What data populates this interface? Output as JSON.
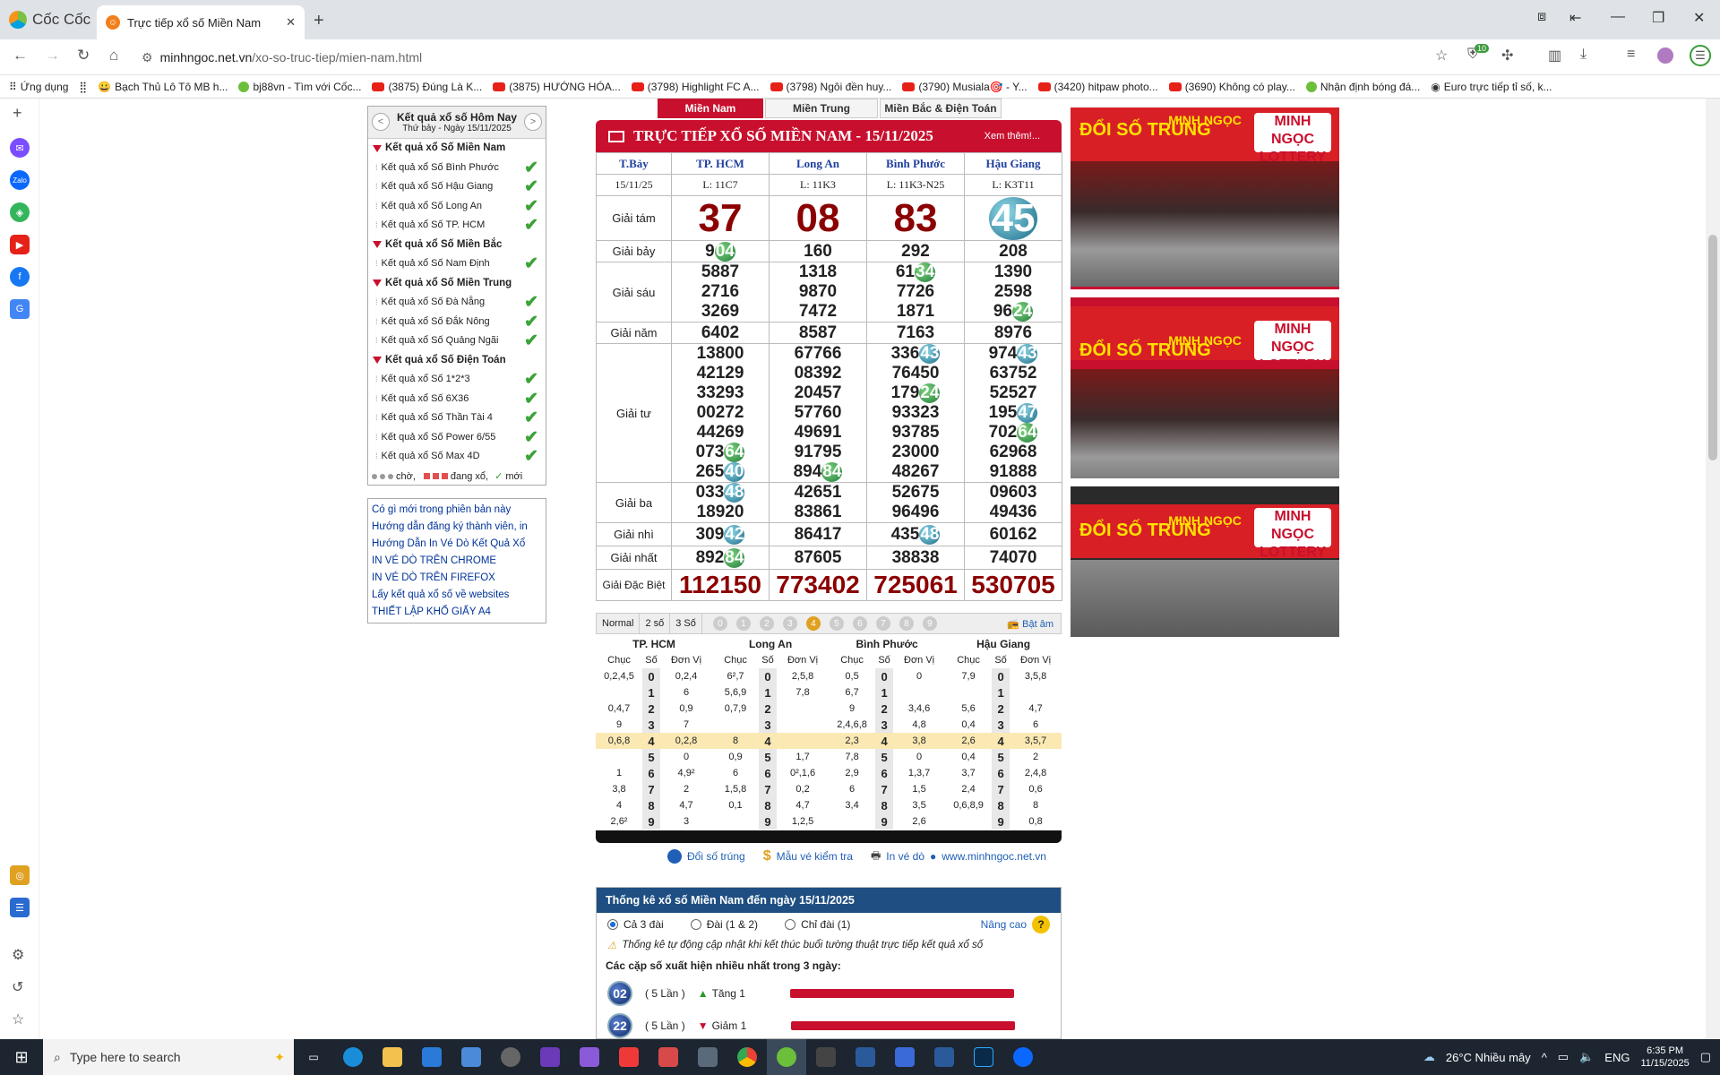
{
  "browser": {
    "app_name": "Cốc Cốc",
    "tab_title": "Trực tiếp xổ số Miền Nam",
    "url_domain": "minhngoc.net.vn",
    "url_path": "/xo-so-truc-tiep/mien-nam.html",
    "ext_badge": "10",
    "bookmarks": [
      "Ứng dụng",
      "Bạch Thủ Lô Tô MB h...",
      "bj88vn - Tìm với Cốc...",
      "(3875) Đúng Là K...",
      "(3875) HƯỚNG HÓA...",
      "(3798) Highlight FC A...",
      "(3798) Ngôi đền huy...",
      "(3790) Musiala🎯 - Y...",
      "(3420) hitpaw photo...",
      "(3690) Không có play...",
      "Nhận định bóng đá...",
      "Euro trực tiếp tỉ số, k..."
    ]
  },
  "sidebar_menu": {
    "title": "Kết quả xổ số Hôm Nay",
    "subtitle": "Thứ bảy - Ngày 15/11/2025",
    "groups": [
      {
        "label": "Kết quả xổ Số Miền Nam",
        "items": [
          "Kết quả xổ Số Bình Phước",
          "Kết quả xổ Số Hậu Giang",
          "Kết quả xổ Số Long An",
          "Kết quả xổ Số TP. HCM"
        ]
      },
      {
        "label": "Kết quả xổ Số Miền Bắc",
        "items": [
          "Kết quả xổ Số Nam Định"
        ]
      },
      {
        "label": "Kết quả xổ Số Miền Trung",
        "items": [
          "Kết quả xổ Số Đà Nẵng",
          "Kết quả xổ Số Đắk Nông",
          "Kết quả xổ Số Quảng Ngãi"
        ]
      },
      {
        "label": "Kết quả xổ Số Điện Toán",
        "items": [
          "Kết quả xổ Số 1*2*3",
          "Kết quả xổ Số 6X36",
          "Kết quả xổ Số Thần Tài 4",
          "Kết quả xổ Số Power 6/55",
          "Kết quả xổ Số Max 4D"
        ]
      }
    ],
    "legend_wait": "chờ,",
    "legend_live": "đang xổ,",
    "legend_new": "mới"
  },
  "info_links": [
    "Có gì mới trong phiên bản này",
    "Hướng dẫn đăng ký thành viên, in",
    "Hướng Dẫn In Vé Dò Kết Quả Xổ",
    "IN VÉ DÒ TRÊN CHROME",
    "IN VÉ DÒ TRÊN FIREFOX",
    "Lấy kết quả xổ số về websites",
    "THIẾT LẬP KHỔ GIẤY A4"
  ],
  "region_tabs": [
    "Miền Nam",
    "Miền Trung",
    "Miền Bắc & Điện Toán"
  ],
  "results": {
    "header": "TRỰC TIẾP XỔ SỐ MIỀN NAM - 15/11/2025",
    "more": "Xem thêm!...",
    "day": "T.Bảy",
    "date": "15/11/25",
    "provinces": [
      "TP. HCM",
      "Long An",
      "Bình Phước",
      "Hậu Giang"
    ],
    "codes": [
      "L: 11C7",
      "L: 11K3",
      "L: 11K3-N25",
      "L: K3T11"
    ],
    "prize_labels": {
      "g8": "Giải tám",
      "g7": "Giải bảy",
      "g6": "Giải sáu",
      "g5": "Giải năm",
      "g4": "Giải tư",
      "g3": "Giải ba",
      "g2": "Giải nhì",
      "g1": "Giải nhất",
      "db": "Giải Đặc Biệt"
    },
    "g8": [
      "37",
      "08",
      "83",
      "45"
    ],
    "g7": [
      "904",
      "160",
      "292",
      "208"
    ],
    "g6": [
      [
        "5887",
        "2716",
        "3269"
      ],
      [
        "1318",
        "9870",
        "7472"
      ],
      [
        "6134",
        "7726",
        "1871"
      ],
      [
        "1390",
        "2598",
        "9624"
      ]
    ],
    "g5": [
      "6402",
      "8587",
      "7163",
      "8976"
    ],
    "g4": [
      [
        "13800",
        "42129",
        "33293",
        "00272",
        "44269",
        "07364",
        "26540"
      ],
      [
        "67766",
        "08392",
        "20457",
        "57760",
        "49691",
        "91795",
        "89484"
      ],
      [
        "33643",
        "76450",
        "17924",
        "93323",
        "93785",
        "23000",
        "48267"
      ],
      [
        "97443",
        "63752",
        "52527",
        "19547",
        "70264",
        "62968",
        "91888"
      ]
    ],
    "g3": [
      [
        "03348",
        "18920"
      ],
      [
        "42651",
        "83861"
      ],
      [
        "52675",
        "96496"
      ],
      [
        "09603",
        "49436"
      ]
    ],
    "g2": [
      "30942",
      "86417",
      "43548",
      "60162"
    ],
    "g1": [
      "89284",
      "87605",
      "38838",
      "74070"
    ],
    "db": [
      "112150",
      "773402",
      "725061",
      "530705"
    ]
  },
  "controls": {
    "modes": [
      "Normal",
      "2 số",
      "3 Số"
    ],
    "digits": [
      "0",
      "1",
      "2",
      "3",
      "4",
      "5",
      "6",
      "7",
      "8",
      "9"
    ],
    "sound": "Bật âm"
  },
  "loto": {
    "col_chuc": "Chục",
    "col_so": "Số",
    "col_donvi": "Đơn Vị",
    "rows": [
      {
        "so": "0",
        "v": [
          [
            "0,2,4,5",
            "0,2,4"
          ],
          [
            "6²,7",
            "2,5,8"
          ],
          [
            "0,5",
            "0"
          ],
          [
            "7,9",
            "3,5,8"
          ]
        ]
      },
      {
        "so": "1",
        "v": [
          [
            "",
            "6"
          ],
          [
            "5,6,9",
            "7,8"
          ],
          [
            "6,7",
            ""
          ],
          [
            "",
            ""
          ]
        ]
      },
      {
        "so": "2",
        "v": [
          [
            "0,4,7",
            "0,9"
          ],
          [
            "0,7,9",
            ""
          ],
          [
            "9",
            "3,4,6"
          ],
          [
            "5,6",
            "4,7"
          ]
        ]
      },
      {
        "so": "3",
        "v": [
          [
            "9",
            "7"
          ],
          [
            "",
            ""
          ],
          [
            "2,4,6,8",
            "4,8"
          ],
          [
            "0,4",
            "6"
          ]
        ]
      },
      {
        "so": "4",
        "v": [
          [
            "0,6,8",
            "0,2,8"
          ],
          [
            "8",
            ""
          ],
          [
            "2,3",
            "3,8"
          ],
          [
            "2,6",
            "3,5,7"
          ]
        ]
      },
      {
        "so": "5",
        "v": [
          [
            "",
            "0"
          ],
          [
            "0,9",
            "1,7"
          ],
          [
            "7,8",
            "0"
          ],
          [
            "0,4",
            "2"
          ]
        ]
      },
      {
        "so": "6",
        "v": [
          [
            "1",
            "4,9²"
          ],
          [
            "6",
            "0²,1,6"
          ],
          [
            "2,9",
            "1,3,7"
          ],
          [
            "3,7",
            "2,4,8"
          ]
        ]
      },
      {
        "so": "7",
        "v": [
          [
            "3,8",
            "2"
          ],
          [
            "1,5,8",
            "0,2"
          ],
          [
            "6",
            "1,5"
          ],
          [
            "2,4",
            "0,6"
          ]
        ]
      },
      {
        "so": "8",
        "v": [
          [
            "4",
            "4,7"
          ],
          [
            "0,1",
            "4,7"
          ],
          [
            "3,4",
            "3,5"
          ],
          [
            "0,6,8,9",
            "8"
          ]
        ]
      },
      {
        "so": "9",
        "v": [
          [
            "2,6²",
            "3"
          ],
          [
            "",
            "1,2,5"
          ],
          [
            "",
            "2,6"
          ],
          [
            "",
            "0,8"
          ]
        ]
      }
    ]
  },
  "bottom_links": [
    "Đổi số trúng",
    "Mẫu vé kiểm tra",
    "In vé dò",
    "www.minhngoc.net.vn"
  ],
  "stats": {
    "title": "Thống kê xổ số Miền Nam đến ngày 15/11/2025",
    "options": [
      "Cả 3 đài",
      "Đài (1 & 2)",
      "Chỉ đài (1)"
    ],
    "advanced": "Nâng cao",
    "note": "Thống kê tự động cập nhật khi kết thúc buổi tường thuật trực tiếp kết quả xổ số",
    "caption": "Các cặp số xuất hiện nhiều nhất trong 3 ngày:",
    "rows": [
      {
        "num": "02",
        "count": "( 5 Lần )",
        "trend": "Tăng 1"
      },
      {
        "num": "22",
        "count": "( 5 Lần )",
        "trend": "Giảm 1"
      }
    ]
  },
  "photos": {
    "sign1": "ĐỔI SỐ TRÚNG",
    "sign2": "MINH NGỌC",
    "sign3": "MINH NGỌC LOTTERY"
  },
  "taskbar": {
    "search": "Type here to search",
    "weather": "26°C  Nhiều mây",
    "lang": "ENG",
    "time": "6:35 PM",
    "date": "11/15/2025"
  }
}
